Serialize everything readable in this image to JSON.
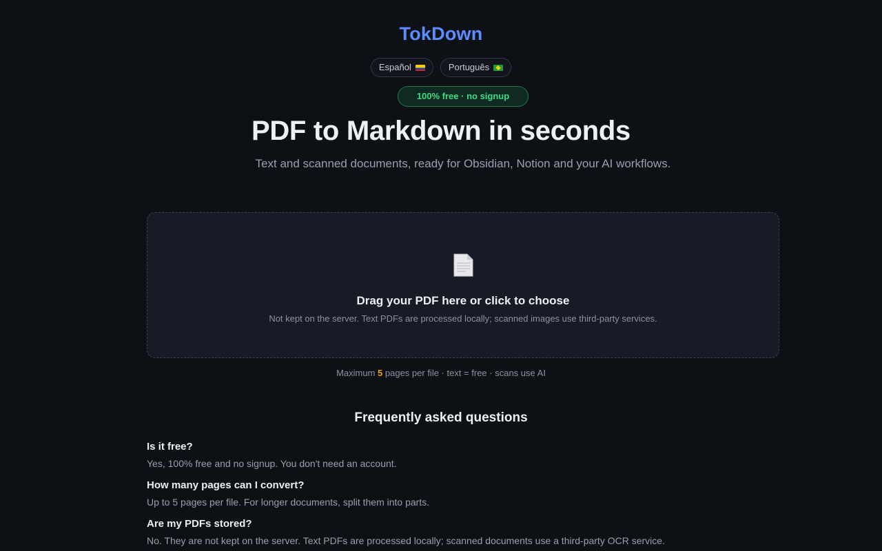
{
  "brand": {
    "name": "TokDown",
    "accent": "#5b8dff"
  },
  "languages": [
    {
      "label": "Español",
      "flag": "colombia-flag"
    },
    {
      "label": "Português",
      "flag": "brazil-flag"
    }
  ],
  "badge": {
    "text": "100% free · no signup",
    "color": "#3ddc84"
  },
  "hero": {
    "title": "PDF to Markdown in seconds",
    "subtitle": "Text and scanned documents, ready for Obsidian, Notion and your AI workflows."
  },
  "dropzone": {
    "icon": "document-icon",
    "title": "Drag your PDF here or click to choose",
    "note": "Not kept on the server. Text PDFs are processed locally; scanned images use third-party services."
  },
  "limits": {
    "prefix": "Maximum",
    "max_pages": "5",
    "suffix": "pages per file · text = free · scans use AI",
    "highlight_color": "#f0a020"
  },
  "faq": {
    "title": "Frequently asked questions",
    "items": [
      {
        "q": "Is it free?",
        "a": "Yes, 100% free and no signup. You don't need an account."
      },
      {
        "q": "How many pages can I convert?",
        "a": "Up to 5 pages per file. For longer documents, split them into parts."
      },
      {
        "q": "Are my PDFs stored?",
        "a": "No. They are not kept on the server. Text PDFs are processed locally; scanned documents use a third-party OCR service."
      }
    ]
  }
}
